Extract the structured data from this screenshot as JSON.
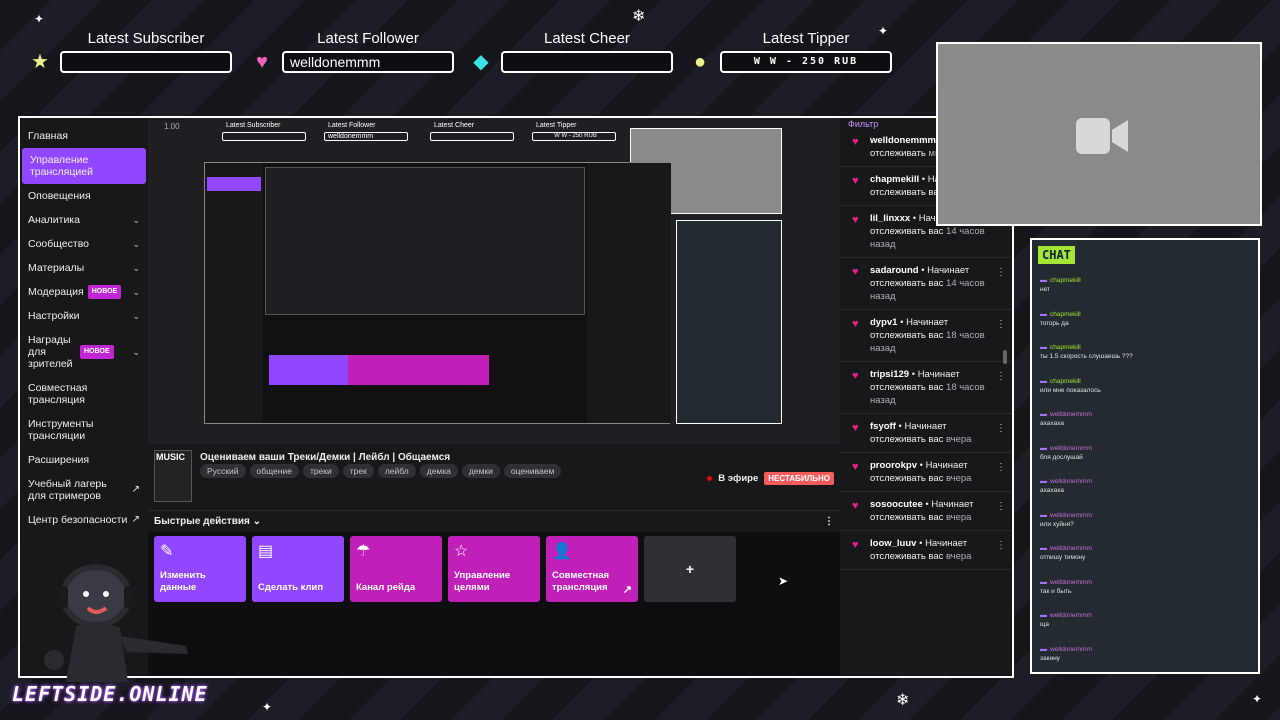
{
  "overlay": {
    "subscriber": {
      "label": "Latest Subscriber",
      "value": ""
    },
    "follower": {
      "label": "Latest Follower",
      "value": "welldonemmm"
    },
    "cheer": {
      "label": "Latest Cheer",
      "value": ""
    },
    "tipper": {
      "label": "Latest Tipper",
      "value": "W W - 250 RUB"
    },
    "logo": "LEFTSIDE.ONLINE"
  },
  "sidebar": {
    "items": [
      {
        "label": "Главная",
        "chevron": false,
        "badge": ""
      },
      {
        "label": "Управление трансляцией",
        "chevron": false,
        "badge": "",
        "active": true
      },
      {
        "label": "Оповещения",
        "chevron": false,
        "badge": ""
      },
      {
        "label": "Аналитика",
        "chevron": true,
        "badge": ""
      },
      {
        "label": "Сообщество",
        "chevron": true,
        "badge": ""
      },
      {
        "label": "Материалы",
        "chevron": true,
        "badge": ""
      },
      {
        "label": "Модерация",
        "chevron": true,
        "badge": "НОВОЕ"
      },
      {
        "label": "Настройки",
        "chevron": true,
        "badge": ""
      },
      {
        "label": "Награды для зрителей",
        "chevron": true,
        "badge": "НОВОЕ"
      },
      {
        "label": "Совместная трансляция",
        "chevron": false,
        "badge": ""
      },
      {
        "label": "Инструменты трансляции",
        "chevron": false,
        "badge": ""
      },
      {
        "label": "Расширения",
        "chevron": false,
        "badge": ""
      },
      {
        "label": "Учебный лагерь для стримеров",
        "chevron": false,
        "badge": "",
        "external": true
      },
      {
        "label": "Центр безопасности",
        "chevron": false,
        "badge": "",
        "external": true
      }
    ]
  },
  "preview": {
    "zoom": "1.00"
  },
  "stream": {
    "thumb_text": "MUSIC",
    "title": "Оцениваем ваши Треки/Демки | Лейбл | Общаемся",
    "tags": [
      "Русский",
      "общение",
      "треки",
      "трек",
      "лейбл",
      "демка",
      "демки",
      "оцениваем"
    ],
    "live_label": "В эфире",
    "status": "НЕСТАБИЛЬНО"
  },
  "quick_actions": {
    "header": "Быстрые действия",
    "tiles": [
      {
        "label": "Изменить данные",
        "icon": "pencil-icon"
      },
      {
        "label": "Сделать клип",
        "icon": "clapper-icon"
      },
      {
        "label": "Канал рейда",
        "icon": "parachute-icon"
      },
      {
        "label": "Управление целями",
        "icon": "star-icon"
      },
      {
        "label": "Совместная трансляция",
        "icon": "add-user-icon"
      }
    ],
    "add": "+"
  },
  "feed": {
    "filter": "Фильтр",
    "items": [
      {
        "user": "welldonemmm",
        "action": "Начинает отслеживать",
        "time": "минут назад"
      },
      {
        "user": "chapmekill",
        "action": "Начинает отслеживать вас",
        "time": "часов назад"
      },
      {
        "user": "lil_linxxx",
        "action": "Начинает отслеживать вас",
        "time": "14 часов назад"
      },
      {
        "user": "sadaround",
        "action": "Начинает отслеживать вас",
        "time": "14 часов назад"
      },
      {
        "user": "dypv1",
        "action": "Начинает отслеживать вас",
        "time": "18 часов назад"
      },
      {
        "user": "tripsi129",
        "action": "Начинает отслеживать вас",
        "time": "18 часов назад"
      },
      {
        "user": "fsyoff",
        "action": "Начинает отслеживать вас",
        "time": "вчера"
      },
      {
        "user": "proorokpv",
        "action": "Начинает отслеживать вас",
        "time": "вчера"
      },
      {
        "user": "sosoocutee",
        "action": "Начинает отслеживать вас",
        "time": "вчера"
      },
      {
        "user": "loow_luuv",
        "action": "Начинает отслеживать вас",
        "time": "вчера"
      }
    ]
  },
  "chat": {
    "header": "CHAT",
    "messages": [
      {
        "user": "chapmekill",
        "text": "нет"
      },
      {
        "user": "chapmekill",
        "text": "тогорь да"
      },
      {
        "user": "chapmekill",
        "text": "ты 1.5 скорость слушаешь ???"
      },
      {
        "user": "chapmekill",
        "text": "или мне показалось"
      },
      {
        "user": "welldonemmm",
        "text": "ахахаха"
      },
      {
        "user": "welldonemmm",
        "text": "бля дослушай"
      },
      {
        "user": "welldonemmm",
        "text": "ахахаха"
      },
      {
        "user": "welldonemmm",
        "text": "или хуйня?"
      },
      {
        "user": "welldonemmm",
        "text": "отпишу тимону"
      },
      {
        "user": "welldonemmm",
        "text": "так и быть"
      },
      {
        "user": "welldonemmm",
        "text": "ща"
      },
      {
        "user": "welldonemmm",
        "text": "закину"
      }
    ]
  },
  "colors": {
    "accent": "#9147ff",
    "magenta": "#c020b8",
    "heart": "#e91e8c",
    "chat_green": "#a3e635"
  }
}
